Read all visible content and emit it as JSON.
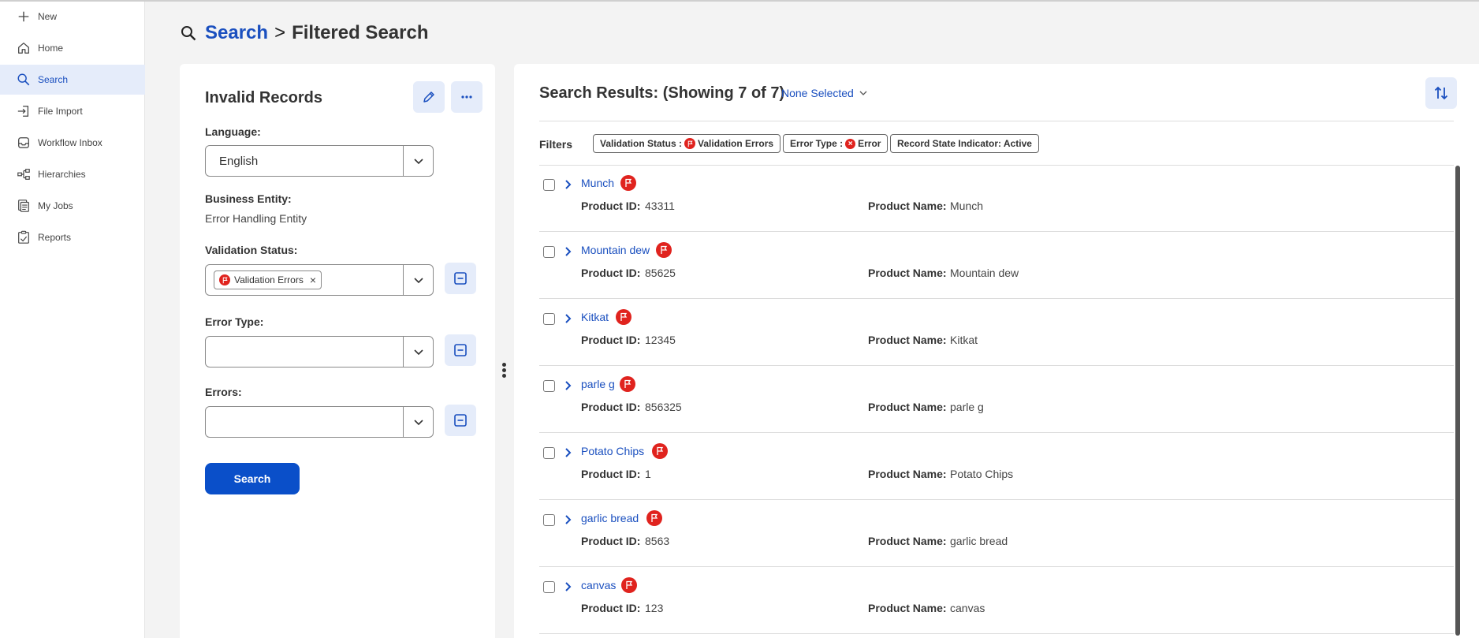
{
  "sidebar": {
    "items": [
      {
        "label": "New",
        "icon": "plus-icon"
      },
      {
        "label": "Home",
        "icon": "home-icon"
      },
      {
        "label": "Search",
        "icon": "search-icon",
        "active": true
      },
      {
        "label": "File Import",
        "icon": "file-import-icon"
      },
      {
        "label": "Workflow Inbox",
        "icon": "inbox-icon"
      },
      {
        "label": "Hierarchies",
        "icon": "hierarchy-icon"
      },
      {
        "label": "My Jobs",
        "icon": "jobs-icon"
      },
      {
        "label": "Reports",
        "icon": "reports-icon"
      }
    ]
  },
  "header": {
    "crumb_root": "Search",
    "separator": ">",
    "crumb_current": "Filtered Search"
  },
  "left_panel": {
    "title": "Invalid Records",
    "language_label": "Language:",
    "language_value": "English",
    "business_entity_label": "Business Entity:",
    "business_entity_value": "Error Handling Entity",
    "validation_status_label": "Validation Status:",
    "validation_status_chip": "Validation Errors",
    "error_type_label": "Error Type:",
    "errors_label": "Errors:",
    "search_button": "Search"
  },
  "results": {
    "title": "Search Results: (Showing 7 of 7)",
    "selection": "None Selected",
    "filters_label": "Filters",
    "filter_chips": {
      "validation_prefix": "Validation Status :",
      "validation_value": "Validation Errors",
      "error_type_prefix": "Error Type :",
      "error_type_value": "Error",
      "record_state": "Record State Indicator: Active"
    },
    "product_id_label": "Product ID:",
    "product_name_label": "Product Name:",
    "rows": [
      {
        "name": "Munch",
        "product_id": "43311",
        "product_name": "Munch"
      },
      {
        "name": "Mountain dew",
        "product_id": "85625",
        "product_name": "Mountain dew"
      },
      {
        "name": "Kitkat",
        "product_id": "12345",
        "product_name": "Kitkat"
      },
      {
        "name": "parle g",
        "product_id": "856325",
        "product_name": "parle g"
      },
      {
        "name": "Potato Chips",
        "product_id": "1",
        "product_name": "Potato Chips"
      },
      {
        "name": "garlic bread",
        "product_id": "8563",
        "product_name": "garlic bread"
      },
      {
        "name": "canvas",
        "product_id": "123",
        "product_name": "canvas"
      }
    ]
  },
  "colors": {
    "accent": "#1a4fbf",
    "primary_button": "#0a4fc9",
    "error_flag": "#e0231e",
    "active_nav_bg": "#e5ecfa"
  }
}
